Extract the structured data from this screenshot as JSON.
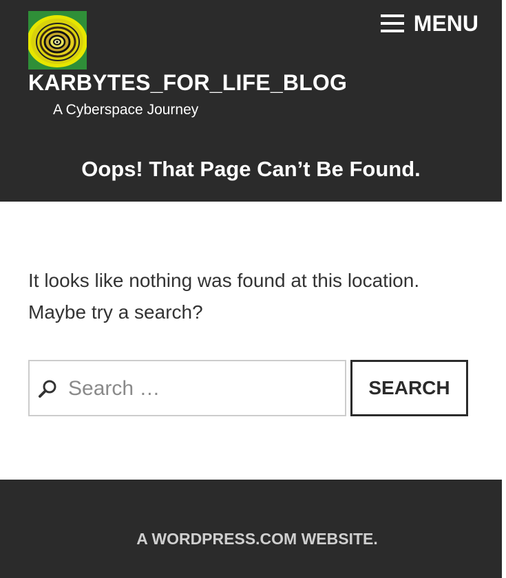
{
  "header": {
    "site_title": "KARBYTES_FOR_LIFE_BLOG",
    "tagline": "A Cyberspace Journey",
    "menu_label": "MENU",
    "logo_icon": "site-logo-spiral-icon",
    "page_heading": "Oops! That Page Can’t Be Found."
  },
  "main": {
    "message": "It looks like nothing was found at this location. Maybe try a search?",
    "search": {
      "placeholder": "Search …",
      "value": "",
      "button_label": "SEARCH",
      "icon": "search-icon"
    }
  },
  "footer": {
    "link_text": "A WORDPRESS.COM WEBSITE."
  },
  "colors": {
    "header_bg": "#2b2b2b",
    "footer_bg": "#2b2b2b",
    "text_light": "#ffffff",
    "footer_text": "#cfcfcf",
    "body_text": "#333333"
  }
}
